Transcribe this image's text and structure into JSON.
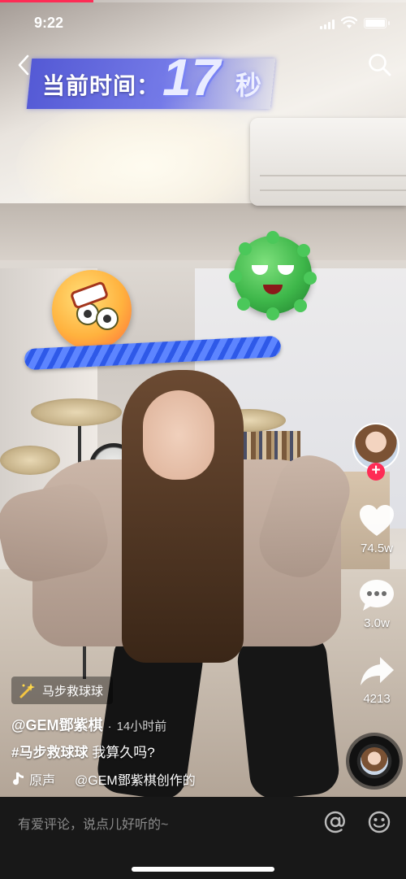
{
  "status_bar": {
    "time": "9:22"
  },
  "playback": {
    "progress_fraction": 0.23
  },
  "game_overlay": {
    "timer_label": "当前时间：",
    "timer_value": "17",
    "timer_unit": "秒"
  },
  "top_bar": {
    "back_icon": "chevron-left-icon",
    "search_icon": "search-icon"
  },
  "right_rail": {
    "avatar_icon": "creator-avatar",
    "follow_icon": "plus-icon",
    "like_count": "74.5w",
    "comment_count": "3.0w",
    "share_count": "4213",
    "accent_color": "#fe2c55"
  },
  "video_info": {
    "effect_name": "马步救球球",
    "author": "@GEM鄧紫棋",
    "separator": "·",
    "post_time": "14小时前",
    "hashtag": "#马步救球球",
    "caption_text": " 我算久吗?",
    "music_label": "原声",
    "music_creator": "@GEM鄧紫棋创作的"
  },
  "comment_bar": {
    "placeholder": "有爱评论，说点儿好听的~",
    "at_icon": "at-icon",
    "emoji_icon": "emoji-icon"
  }
}
